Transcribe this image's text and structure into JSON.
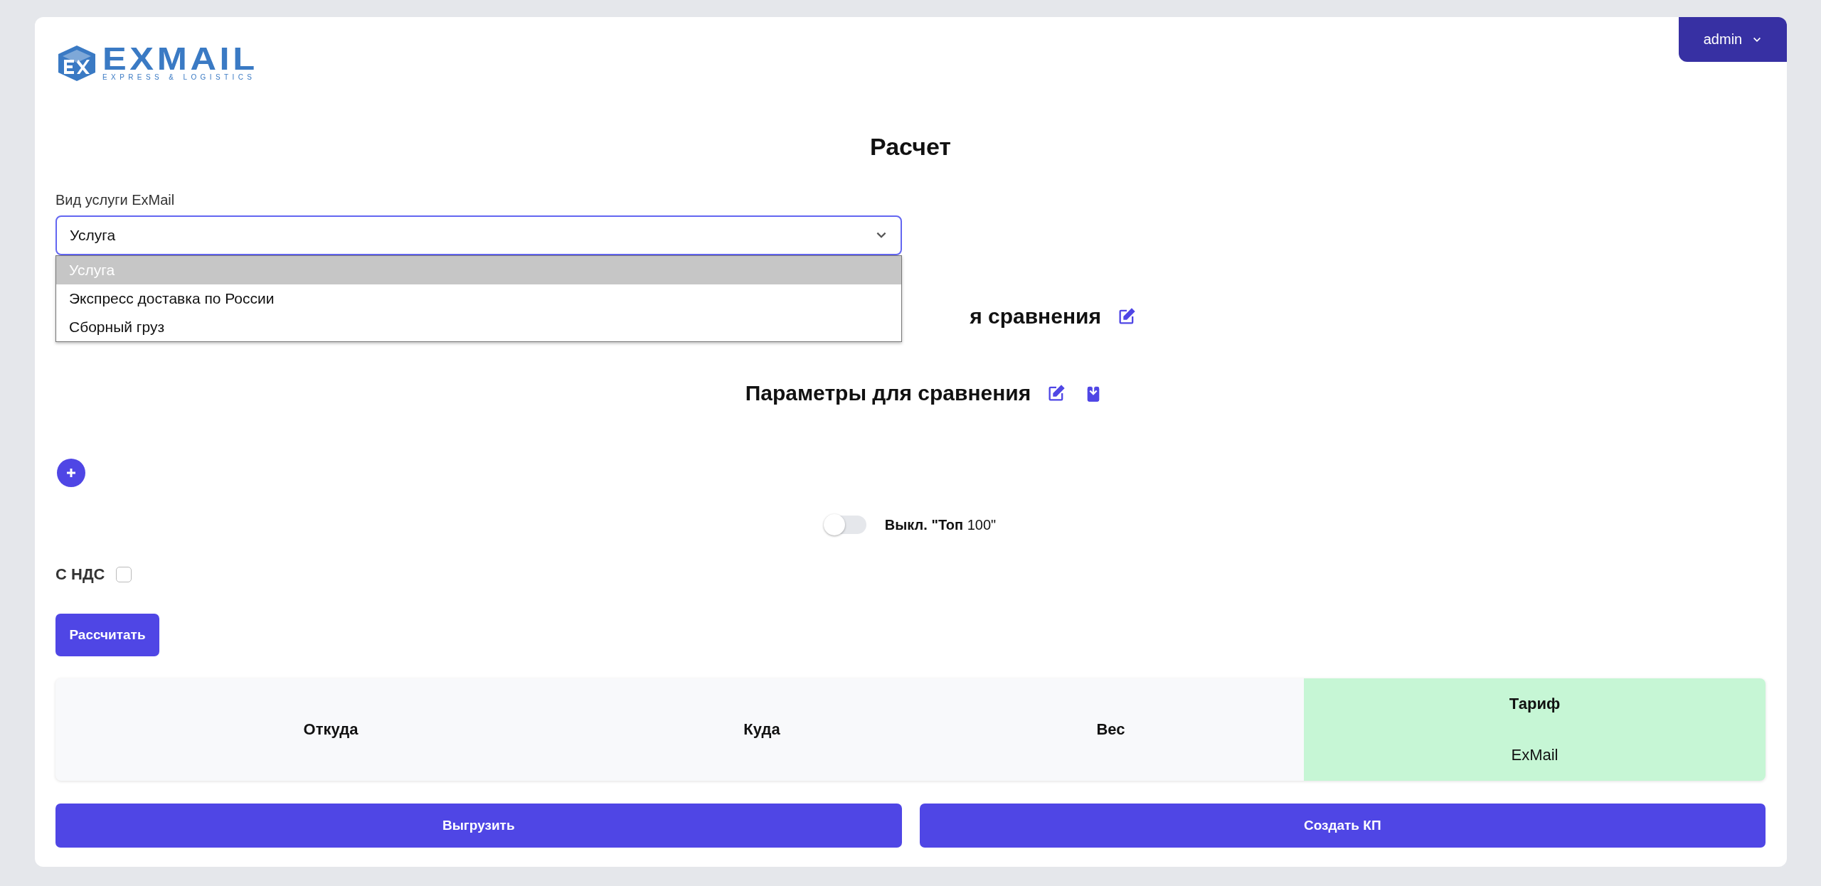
{
  "user_menu": {
    "label": "admin"
  },
  "logo": {
    "name": "EXMAIL",
    "tagline": "EXPRESS & LOGISTICS"
  },
  "title": "Расчет",
  "service_select": {
    "label": "Вид услуги ExMail",
    "value": "Услуга",
    "expanded": true,
    "options": [
      {
        "label": "Услуга",
        "selected": true
      },
      {
        "label": "Экспресс доставка по России",
        "selected": false
      },
      {
        "label": "Сборный груз",
        "selected": false
      }
    ]
  },
  "sections": [
    {
      "title": "я сравнения",
      "actions": [
        {
          "kind": "edit"
        }
      ]
    },
    {
      "title": "Параметры для сравнения",
      "actions": [
        {
          "kind": "edit"
        },
        {
          "kind": "download"
        }
      ]
    }
  ],
  "top100_toggle": {
    "on": false,
    "label": "**Выкл. \"Топ** 100\""
  },
  "vat": {
    "label": "С НДС",
    "checked": false
  },
  "calculate_button": "Рассчитать",
  "results_table": {
    "columns": [
      {
        "label": "Откуда",
        "highlighted": false
      },
      {
        "label": "Куда",
        "highlighted": false
      },
      {
        "label": "Вес",
        "highlighted": false
      },
      {
        "label": "Тариф",
        "highlighted": true,
        "sub_label": "ExMail"
      }
    ]
  },
  "footer_buttons": [
    "Выгрузить",
    "Создать КП"
  ]
}
